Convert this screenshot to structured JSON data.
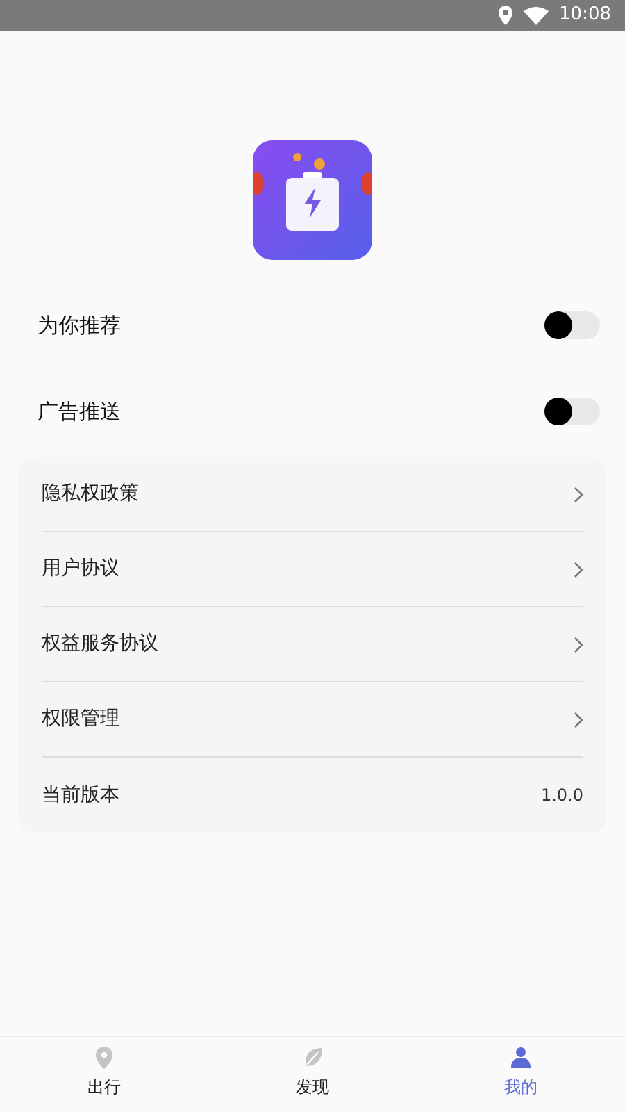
{
  "status_bar": {
    "time": "10:08"
  },
  "toggles": [
    {
      "label": "为你推荐",
      "on": false
    },
    {
      "label": "广告推送",
      "on": false
    }
  ],
  "menu": [
    {
      "label": "隐私权政策",
      "kind": "link"
    },
    {
      "label": "用户协议",
      "kind": "link"
    },
    {
      "label": "权益服务协议",
      "kind": "link"
    },
    {
      "label": "权限管理",
      "kind": "link"
    },
    {
      "label": "当前版本",
      "kind": "value",
      "value": "1.0.0"
    }
  ],
  "bottom_nav": [
    {
      "label": "出行",
      "selected": false,
      "kind": "pin"
    },
    {
      "label": "发现",
      "selected": false,
      "kind": "leaf"
    },
    {
      "label": "我的",
      "selected": true,
      "kind": "person"
    }
  ]
}
